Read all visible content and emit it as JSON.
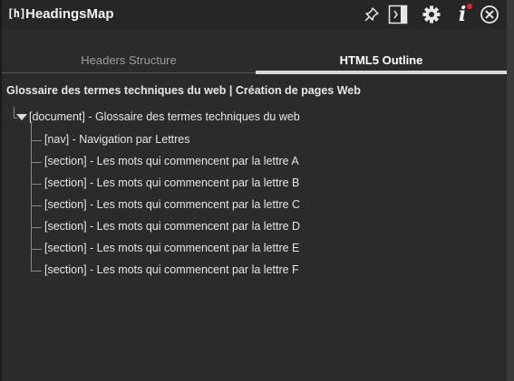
{
  "app": {
    "logo_text": "[h]",
    "title": "HeadingsMap"
  },
  "toolbar": {
    "icons": [
      "pin-icon",
      "sidebar-toggle-icon",
      "gear-icon",
      "info-icon",
      "close-icon"
    ],
    "notification_color": "#e0262b"
  },
  "tabs": [
    {
      "label": "Headers Structure",
      "active": false
    },
    {
      "label": "HTML5 Outline",
      "active": true
    }
  ],
  "outline": {
    "page_title": "Glossaire des termes techniques du web | Création de pages Web",
    "root": {
      "label": "[document] - Glossaire des termes techniques du web",
      "expanded": true,
      "children": [
        {
          "label": "[nav] - Navigation par Lettres"
        },
        {
          "label": "[section] - Les mots qui commencent par la lettre A"
        },
        {
          "label": "[section] - Les mots qui commencent par la lettre B"
        },
        {
          "label": "[section] - Les mots qui commencent par la lettre C"
        },
        {
          "label": "[section] - Les mots qui commencent par la lettre D"
        },
        {
          "label": "[section] - Les mots qui commencent par la lettre E"
        },
        {
          "label": "[section] - Les mots qui commencent par la lettre F"
        }
      ]
    }
  }
}
